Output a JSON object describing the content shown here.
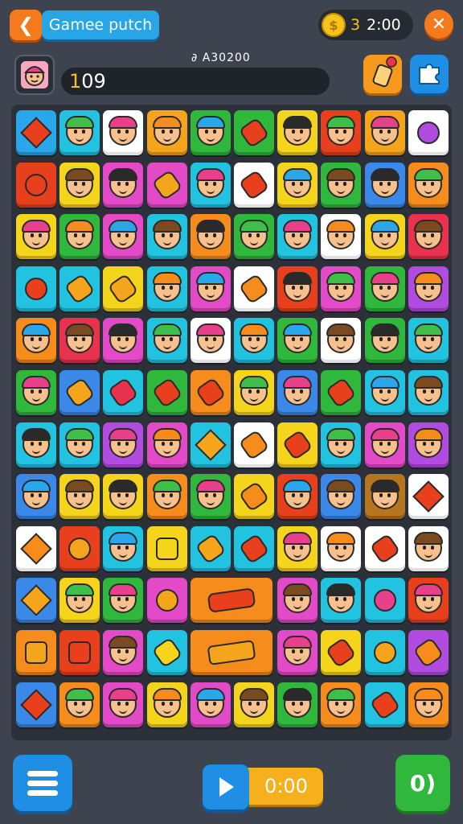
{
  "header": {
    "back_icon": "arrow-left-icon",
    "title": "Gamee putch",
    "coins": "3",
    "timer": "2:00",
    "close_icon": "close-icon"
  },
  "player": {
    "avatar_icon": "player-avatar-icon",
    "score_label": "∂ A30200",
    "score_first": "1",
    "score_rest": "09",
    "powerup_icon": "bottle-powerup-icon",
    "puzzle_icon": "puzzle-icon"
  },
  "board": {
    "rows": 12,
    "cols": 10,
    "colors": {
      "B": "#2aa7ea",
      "C": "#22c3e0",
      "W": "#ffffff",
      "O": "#f5a51c",
      "G": "#2fb83c",
      "Y": "#f5d41c",
      "R": "#e8401c",
      "P": "#e34ac7",
      "V": "#b24be0",
      "K": "#e8324e",
      "N": "#b87520",
      "T": "#3a88e8",
      "L": "#f58c1c"
    },
    "tiles": [
      {
        "row": 0,
        "col": 0,
        "color": "B",
        "icon": "flame-icon"
      },
      {
        "row": 0,
        "col": 1,
        "color": "C",
        "icon": "face-icon"
      },
      {
        "row": 0,
        "col": 2,
        "color": "W",
        "icon": "face-icon"
      },
      {
        "row": 0,
        "col": 3,
        "color": "O",
        "icon": "face-icon"
      },
      {
        "row": 0,
        "col": 4,
        "color": "G",
        "icon": "face-icon"
      },
      {
        "row": 0,
        "col": 5,
        "color": "G",
        "icon": "pepper-icon"
      },
      {
        "row": 0,
        "col": 6,
        "color": "Y",
        "icon": "face-icon"
      },
      {
        "row": 0,
        "col": 7,
        "color": "R",
        "icon": "face-icon"
      },
      {
        "row": 0,
        "col": 8,
        "color": "O",
        "icon": "face-icon"
      },
      {
        "row": 0,
        "col": 9,
        "color": "W",
        "icon": "fruit-icon"
      },
      {
        "row": 1,
        "col": 0,
        "color": "R",
        "icon": "strawberry-icon"
      },
      {
        "row": 1,
        "col": 1,
        "color": "Y",
        "icon": "face-icon"
      },
      {
        "row": 1,
        "col": 2,
        "color": "P",
        "icon": "face-icon"
      },
      {
        "row": 1,
        "col": 3,
        "color": "P",
        "icon": "candy-icon"
      },
      {
        "row": 1,
        "col": 4,
        "color": "C",
        "icon": "face-icon"
      },
      {
        "row": 1,
        "col": 5,
        "color": "W",
        "icon": "bottle-icon"
      },
      {
        "row": 1,
        "col": 6,
        "color": "Y",
        "icon": "face-icon"
      },
      {
        "row": 1,
        "col": 7,
        "color": "G",
        "icon": "face-icon"
      },
      {
        "row": 1,
        "col": 8,
        "color": "T",
        "icon": "face-icon"
      },
      {
        "row": 1,
        "col": 9,
        "color": "L",
        "icon": "face-icon"
      },
      {
        "row": 2,
        "col": 0,
        "color": "Y",
        "icon": "face-icon"
      },
      {
        "row": 2,
        "col": 1,
        "color": "G",
        "icon": "face-icon"
      },
      {
        "row": 2,
        "col": 2,
        "color": "P",
        "icon": "face-icon"
      },
      {
        "row": 2,
        "col": 3,
        "color": "C",
        "icon": "face-icon"
      },
      {
        "row": 2,
        "col": 4,
        "color": "L",
        "icon": "face-icon"
      },
      {
        "row": 2,
        "col": 5,
        "color": "G",
        "icon": "face-icon"
      },
      {
        "row": 2,
        "col": 6,
        "color": "C",
        "icon": "face-icon"
      },
      {
        "row": 2,
        "col": 7,
        "color": "W",
        "icon": "face-icon"
      },
      {
        "row": 2,
        "col": 8,
        "color": "Y",
        "icon": "face-icon"
      },
      {
        "row": 2,
        "col": 9,
        "color": "K",
        "icon": "face-icon"
      },
      {
        "row": 3,
        "col": 0,
        "color": "C",
        "icon": "bell-pepper-icon"
      },
      {
        "row": 3,
        "col": 1,
        "color": "C",
        "icon": "candy-icon"
      },
      {
        "row": 3,
        "col": 2,
        "color": "Y",
        "icon": "candy-icon"
      },
      {
        "row": 3,
        "col": 3,
        "color": "C",
        "icon": "face-icon"
      },
      {
        "row": 3,
        "col": 4,
        "color": "P",
        "icon": "face-icon"
      },
      {
        "row": 3,
        "col": 5,
        "color": "W",
        "icon": "carrot-icon"
      },
      {
        "row": 3,
        "col": 6,
        "color": "R",
        "icon": "face-icon"
      },
      {
        "row": 3,
        "col": 7,
        "color": "P",
        "icon": "face-icon"
      },
      {
        "row": 3,
        "col": 8,
        "color": "G",
        "icon": "face-icon"
      },
      {
        "row": 3,
        "col": 9,
        "color": "V",
        "icon": "face-icon"
      },
      {
        "row": 4,
        "col": 0,
        "color": "L",
        "icon": "face-icon"
      },
      {
        "row": 4,
        "col": 1,
        "color": "K",
        "icon": "face-icon"
      },
      {
        "row": 4,
        "col": 2,
        "color": "P",
        "icon": "face-icon"
      },
      {
        "row": 4,
        "col": 3,
        "color": "C",
        "icon": "face-icon"
      },
      {
        "row": 4,
        "col": 4,
        "color": "W",
        "icon": "face-icon"
      },
      {
        "row": 4,
        "col": 5,
        "color": "C",
        "icon": "face-icon"
      },
      {
        "row": 4,
        "col": 6,
        "color": "G",
        "icon": "face-icon"
      },
      {
        "row": 4,
        "col": 7,
        "color": "W",
        "icon": "face-icon"
      },
      {
        "row": 4,
        "col": 8,
        "color": "G",
        "icon": "face-icon"
      },
      {
        "row": 4,
        "col": 9,
        "color": "C",
        "icon": "face-icon"
      },
      {
        "row": 5,
        "col": 0,
        "color": "G",
        "icon": "face-icon"
      },
      {
        "row": 5,
        "col": 1,
        "color": "T",
        "icon": "candy-icon"
      },
      {
        "row": 5,
        "col": 2,
        "color": "C",
        "icon": "chopsticks-icon"
      },
      {
        "row": 5,
        "col": 3,
        "color": "G",
        "icon": "bottle-icon"
      },
      {
        "row": 5,
        "col": 4,
        "color": "L",
        "icon": "leaf-icon"
      },
      {
        "row": 5,
        "col": 5,
        "color": "Y",
        "icon": "face-icon"
      },
      {
        "row": 5,
        "col": 6,
        "color": "T",
        "icon": "face-icon"
      },
      {
        "row": 5,
        "col": 7,
        "color": "G",
        "icon": "bottle-icon"
      },
      {
        "row": 5,
        "col": 8,
        "color": "C",
        "icon": "face-icon"
      },
      {
        "row": 5,
        "col": 9,
        "color": "C",
        "icon": "face-icon"
      },
      {
        "row": 6,
        "col": 0,
        "color": "C",
        "icon": "face-icon"
      },
      {
        "row": 6,
        "col": 1,
        "color": "C",
        "icon": "face-icon"
      },
      {
        "row": 6,
        "col": 2,
        "color": "V",
        "icon": "face-icon"
      },
      {
        "row": 6,
        "col": 3,
        "color": "P",
        "icon": "face-icon"
      },
      {
        "row": 6,
        "col": 4,
        "color": "C",
        "icon": "splash-icon"
      },
      {
        "row": 6,
        "col": 5,
        "color": "W",
        "icon": "carrot-icon"
      },
      {
        "row": 6,
        "col": 6,
        "color": "Y",
        "icon": "bottle-icon"
      },
      {
        "row": 6,
        "col": 7,
        "color": "C",
        "icon": "face-icon"
      },
      {
        "row": 6,
        "col": 8,
        "color": "P",
        "icon": "face-icon"
      },
      {
        "row": 6,
        "col": 9,
        "color": "V",
        "icon": "face-icon"
      },
      {
        "row": 7,
        "col": 0,
        "color": "T",
        "icon": "face-icon"
      },
      {
        "row": 7,
        "col": 1,
        "color": "Y",
        "icon": "face-icon"
      },
      {
        "row": 7,
        "col": 2,
        "color": "Y",
        "icon": "face-icon"
      },
      {
        "row": 7,
        "col": 3,
        "color": "L",
        "icon": "face-icon"
      },
      {
        "row": 7,
        "col": 4,
        "color": "G",
        "icon": "face-icon"
      },
      {
        "row": 7,
        "col": 5,
        "color": "Y",
        "icon": "carrot-icon"
      },
      {
        "row": 7,
        "col": 6,
        "color": "R",
        "icon": "face-icon"
      },
      {
        "row": 7,
        "col": 7,
        "color": "T",
        "icon": "face-icon"
      },
      {
        "row": 7,
        "col": 8,
        "color": "N",
        "icon": "face-icon"
      },
      {
        "row": 7,
        "col": 9,
        "color": "W",
        "icon": "fire-icon"
      },
      {
        "row": 8,
        "col": 0,
        "color": "W",
        "icon": "star-icon"
      },
      {
        "row": 8,
        "col": 1,
        "color": "R",
        "icon": "heart-icon"
      },
      {
        "row": 8,
        "col": 2,
        "color": "C",
        "icon": "face-icon"
      },
      {
        "row": 8,
        "col": 3,
        "color": "Y",
        "icon": "bag-icon"
      },
      {
        "row": 8,
        "col": 4,
        "color": "C",
        "icon": "candy-icon"
      },
      {
        "row": 8,
        "col": 5,
        "color": "C",
        "icon": "bottle-icon"
      },
      {
        "row": 8,
        "col": 6,
        "color": "Y",
        "icon": "face-icon"
      },
      {
        "row": 8,
        "col": 7,
        "color": "W",
        "icon": "face-icon"
      },
      {
        "row": 8,
        "col": 8,
        "color": "W",
        "icon": "bottle-icon"
      },
      {
        "row": 8,
        "col": 9,
        "color": "W",
        "icon": "face-icon"
      },
      {
        "row": 9,
        "col": 0,
        "color": "T",
        "icon": "splash-icon"
      },
      {
        "row": 9,
        "col": 1,
        "color": "Y",
        "icon": "face-icon"
      },
      {
        "row": 9,
        "col": 2,
        "color": "G",
        "icon": "face-icon"
      },
      {
        "row": 9,
        "col": 3,
        "color": "P",
        "icon": "heart-icon"
      },
      {
        "row": 9,
        "col": 4,
        "color": "L",
        "icon": "pepper-icon",
        "span": 2
      },
      {
        "row": 9,
        "col": 6,
        "color": "P",
        "icon": "face-icon"
      },
      {
        "row": 9,
        "col": 7,
        "color": "C",
        "icon": "face-icon"
      },
      {
        "row": 9,
        "col": 8,
        "color": "C",
        "icon": "flower-icon"
      },
      {
        "row": 9,
        "col": 9,
        "color": "R",
        "icon": "face-icon"
      },
      {
        "row": 10,
        "col": 0,
        "color": "L",
        "icon": "pineapple-icon"
      },
      {
        "row": 10,
        "col": 1,
        "color": "R",
        "icon": "house-icon"
      },
      {
        "row": 10,
        "col": 2,
        "color": "P",
        "icon": "face-icon"
      },
      {
        "row": 10,
        "col": 3,
        "color": "C",
        "icon": "corn-icon"
      },
      {
        "row": 10,
        "col": 4,
        "color": "L",
        "icon": "palette-icon",
        "span": 2
      },
      {
        "row": 10,
        "col": 6,
        "color": "P",
        "icon": "face-icon"
      },
      {
        "row": 10,
        "col": 7,
        "color": "Y",
        "icon": "leaf-icon"
      },
      {
        "row": 10,
        "col": 8,
        "color": "C",
        "icon": "heart-icon"
      },
      {
        "row": 10,
        "col": 9,
        "color": "V",
        "icon": "carrot-icon"
      },
      {
        "row": 11,
        "col": 0,
        "color": "T",
        "icon": "fire-icon"
      },
      {
        "row": 11,
        "col": 1,
        "color": "L",
        "icon": "face-icon"
      },
      {
        "row": 11,
        "col": 2,
        "color": "P",
        "icon": "face-icon"
      },
      {
        "row": 11,
        "col": 3,
        "color": "Y",
        "icon": "face-icon"
      },
      {
        "row": 11,
        "col": 4,
        "color": "P",
        "icon": "face-icon"
      },
      {
        "row": 11,
        "col": 5,
        "color": "Y",
        "icon": "face-icon"
      },
      {
        "row": 11,
        "col": 6,
        "color": "G",
        "icon": "face-icon"
      },
      {
        "row": 11,
        "col": 7,
        "color": "L",
        "icon": "face-icon"
      },
      {
        "row": 11,
        "col": 8,
        "color": "C",
        "icon": "leaf-icon"
      },
      {
        "row": 11,
        "col": 9,
        "color": "L",
        "icon": "face-icon"
      }
    ]
  },
  "footer": {
    "menu_icon": "menu-icon",
    "play_icon": "play-icon",
    "play_time": "0:00",
    "go_label": "0)"
  }
}
